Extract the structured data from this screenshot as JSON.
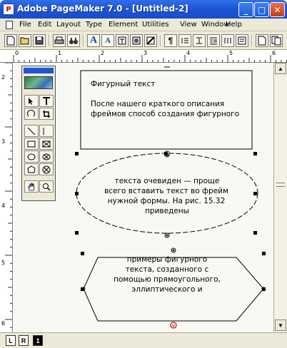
{
  "window": {
    "title": "Adobe PageMaker 7.0 - [Untitled-2]",
    "app_icon_glyph": "P",
    "minimize_glyph": "_",
    "maximize_glyph": "□",
    "close_glyph": "✕"
  },
  "menu": [
    "File",
    "Edit",
    "Layout",
    "Type",
    "Element",
    "Utilities",
    "View",
    "Window",
    "Help"
  ],
  "toolbar": {
    "font_large_glyph": "A",
    "font_small_glyph": "A",
    "paragraph_glyph": "¶"
  },
  "rulers": {
    "horizontal": [
      "0",
      "1",
      "2",
      "3",
      "4",
      "5",
      "6"
    ],
    "vertical": [
      "2",
      "3",
      "4",
      "5",
      "6"
    ]
  },
  "frames": {
    "rect": {
      "heading": "Фигурный текст",
      "lines": [
        "После нашего краткого описания",
        "фреймов способ создания фигурного"
      ]
    },
    "ellipse": {
      "lines": [
        "текста очевиден — проще",
        "всего вставить текст во фрейм",
        "нужной формы. На рис. 15.32",
        "приведены"
      ]
    },
    "hexagon": {
      "lines": [
        "примеры фигурного",
        "текста, созданного с",
        "помощью прямоугольного,",
        "эллиптического и"
      ]
    }
  },
  "bottom_bar": {
    "left_master": "L",
    "right_master": "R",
    "current_page": "1"
  },
  "colors": {
    "titlebar": "#1e56d6",
    "chrome": "#ece9d8",
    "overflow_handle": "#d03020"
  }
}
